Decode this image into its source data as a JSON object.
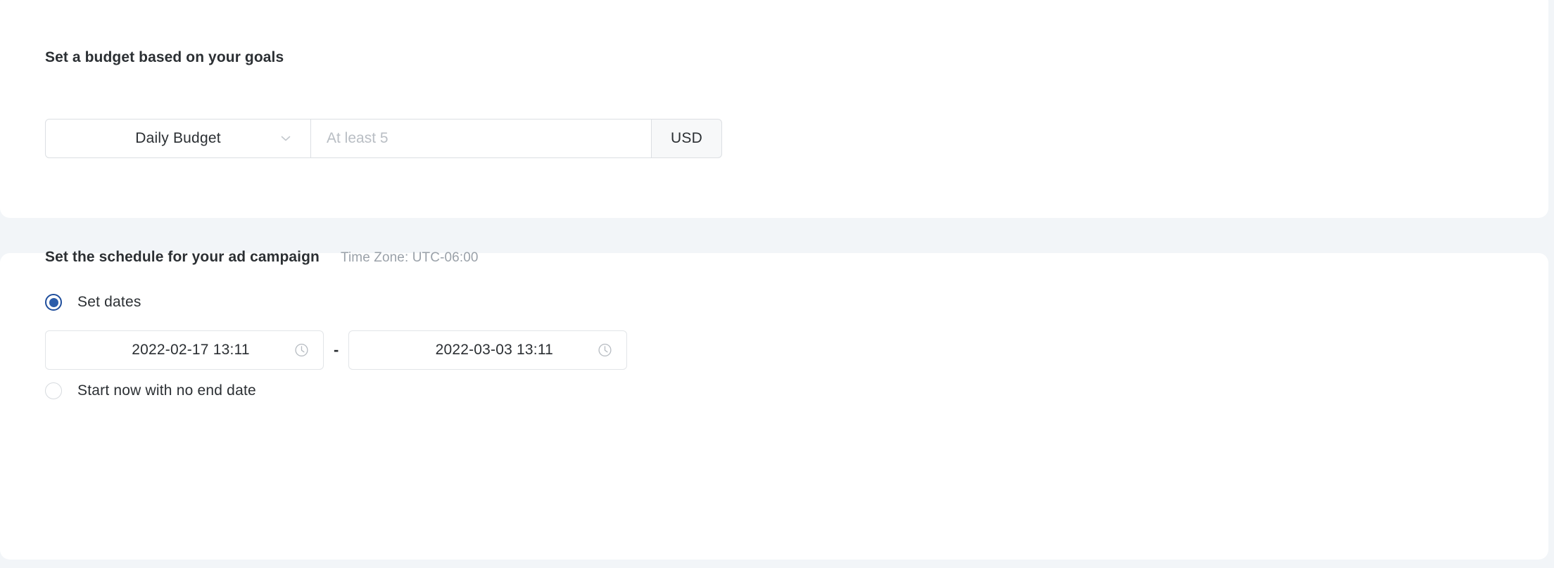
{
  "theme": {
    "page_background": "#f2f5f8",
    "card_background": "#ffffff",
    "text_primary": "#2b2f33",
    "text_muted": "#9aa1a9",
    "placeholder": "#b9bec4",
    "border": "#dcdfe3",
    "accent_radio": "#2a5caa",
    "currency_background": "#f7f8f9"
  },
  "budget_section": {
    "title": "Set a budget based on your goals",
    "budget_type": {
      "selected": "Daily Budget",
      "icon": "chevron-down-icon"
    },
    "amount": {
      "value": "",
      "placeholder": "At least 5"
    },
    "currency": "USD"
  },
  "schedule_section": {
    "title": "Set the schedule for your ad campaign",
    "timezone": "Time Zone: UTC-06:00",
    "options": [
      {
        "label": "Set dates",
        "selected": true
      },
      {
        "label": "Start now with no end date",
        "selected": false
      }
    ],
    "date_range": {
      "start": "2022-02-17 13:11",
      "end": "2022-03-03 13:11",
      "separator": "-",
      "icon": "clock-icon"
    }
  }
}
